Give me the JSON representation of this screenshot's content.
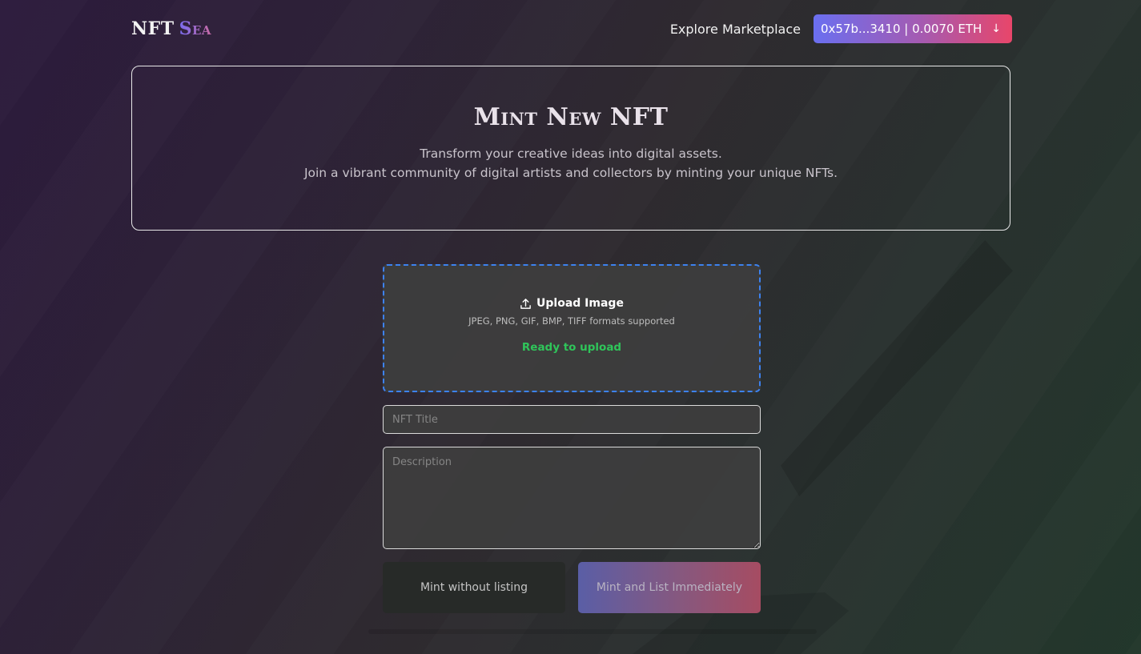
{
  "header": {
    "logo_part1": "NFT",
    "logo_part2": "Sea",
    "nav_explore": "Explore Marketplace",
    "wallet_label": "0x57b...3410 | 0.0070 ETH",
    "wallet_arrow": "↓"
  },
  "hero": {
    "title": "Mint New NFT",
    "line1": "Transform your creative ideas into digital assets.",
    "line2": "Join a vibrant community of digital artists and collectors by minting your unique NFTs."
  },
  "upload": {
    "label": "Upload Image",
    "formats": "JPEG, PNG, GIF, BMP, TIFF formats supported",
    "status": "Ready to upload",
    "status_color": "#2fc55a",
    "border_color": "#3c82f0",
    "icon": "upload-icon"
  },
  "form": {
    "title_placeholder": "NFT Title",
    "description_placeholder": "Description"
  },
  "buttons": {
    "mint_only": "Mint without listing",
    "mint_and_list": "Mint and List Immediately"
  },
  "colors": {
    "wallet_gradient_start": "#6a6ff0",
    "wallet_gradient_end": "#e8466a"
  }
}
